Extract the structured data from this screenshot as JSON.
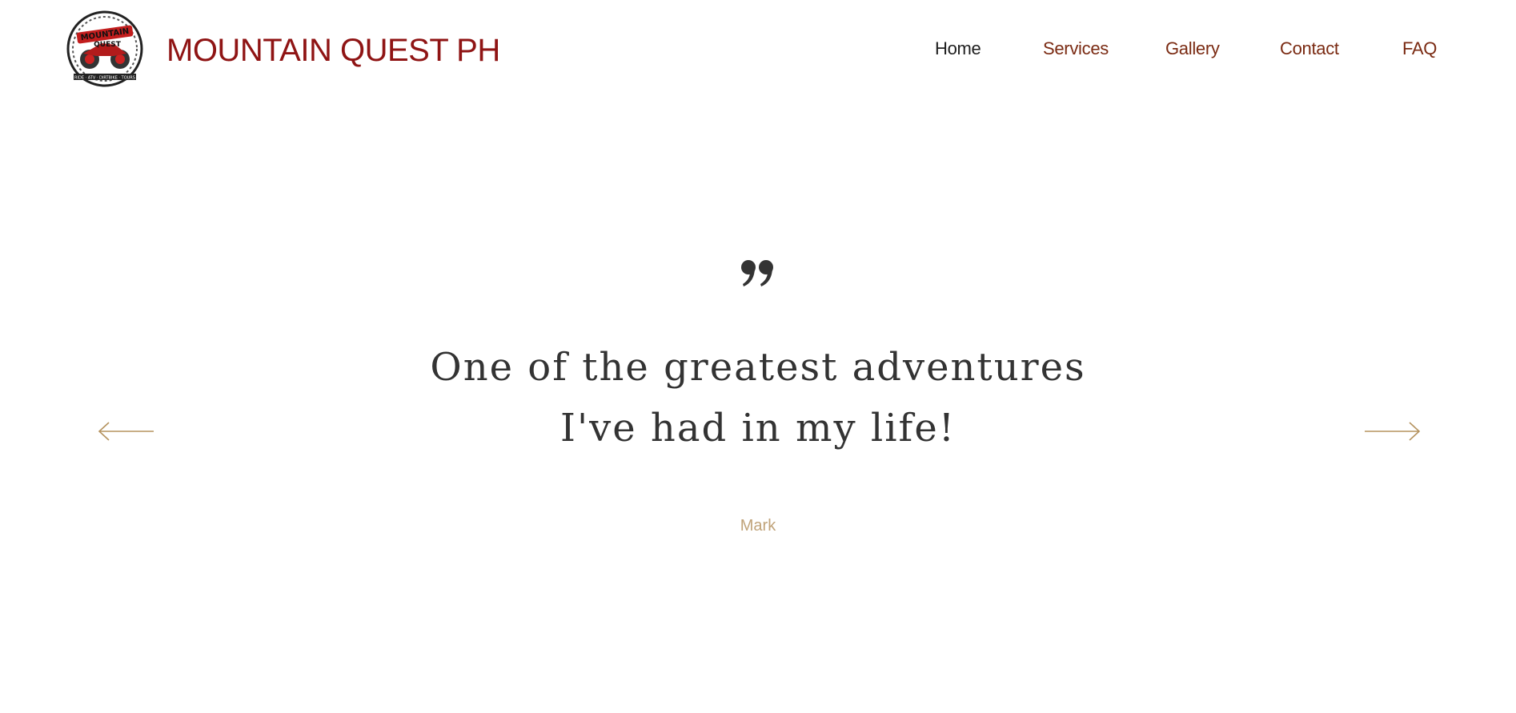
{
  "header": {
    "site_title": "MOUNTAIN QUEST PH",
    "logo": {
      "icon": "mountain-quest-logo",
      "text_top": "MOUNTAIN",
      "text_mid": "QUEST",
      "text_bottom": "RIDE · ATV · DIRTBIKE · TOURS"
    }
  },
  "nav": {
    "items": [
      {
        "label": "Home",
        "active": true
      },
      {
        "label": "Services",
        "active": false
      },
      {
        "label": "Gallery",
        "active": false
      },
      {
        "label": "Contact",
        "active": false
      },
      {
        "label": "FAQ",
        "active": false
      }
    ]
  },
  "testimonial": {
    "quote_icon": "quotation-mark-icon",
    "line1": "One of the greatest adventures",
    "line2": "I've had in my life!",
    "author": "Mark",
    "prev_icon": "arrow-left-icon",
    "next_icon": "arrow-right-icon"
  },
  "colors": {
    "brand_red": "#8f1414",
    "nav_brown": "#7a2a12",
    "nav_active": "#1f1f1f",
    "accent_gold": "#c0a379",
    "text_dark": "#333333"
  }
}
